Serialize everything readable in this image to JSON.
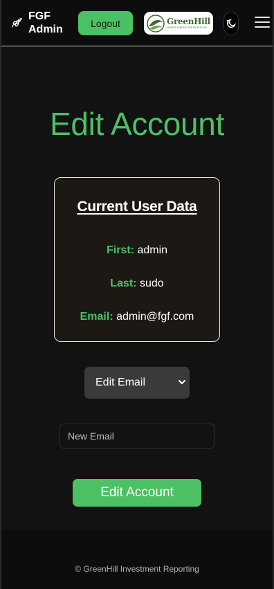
{
  "header": {
    "brand": "FGF Admin",
    "logout_label": "Logout",
    "logo_name": "GreenHill",
    "logo_tagline": "INVESTMENT REPORTING",
    "icons": {
      "brand": "rocket-icon",
      "theme": "moon-icon",
      "menu": "hamburger-menu-icon"
    }
  },
  "main": {
    "title": "Edit Account",
    "card": {
      "title": "Current User Data",
      "fields": [
        {
          "label": "First:",
          "value": "admin"
        },
        {
          "label": "Last:",
          "value": "sudo"
        },
        {
          "label": "Email:",
          "value": "admin@fgf.com"
        }
      ]
    },
    "select": {
      "selected": "Edit Email"
    },
    "input": {
      "placeholder": "New Email",
      "value": ""
    },
    "submit_label": "Edit Account"
  },
  "footer": {
    "text": "© GreenHill Investment Reporting"
  },
  "colors": {
    "accent": "#4cc163",
    "background": "#121212",
    "card_background": "#1c1915"
  }
}
